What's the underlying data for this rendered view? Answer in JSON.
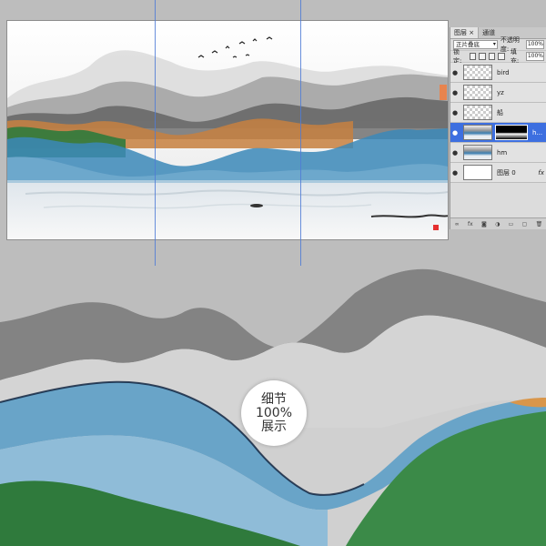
{
  "layers_panel": {
    "tabs": [
      "图层 ×",
      "通道"
    ],
    "blend_mode": "正片叠底",
    "opacity_label": "不透明度:",
    "opacity_value": "100%",
    "lock_label": "锁定:",
    "fill_label": "填充:",
    "fill_value": "100%",
    "layers": [
      {
        "name": "bird",
        "thumb": "transparent",
        "selected": false,
        "fx": false
      },
      {
        "name": "yz",
        "thumb": "transparent",
        "selected": false,
        "fx": false
      },
      {
        "name": "船",
        "thumb": "transparent",
        "selected": false,
        "fx": false
      },
      {
        "name": "h...",
        "thumb": "landscape-with-mask",
        "selected": true,
        "fx": false
      },
      {
        "name": "hm",
        "thumb": "landscape",
        "selected": false,
        "fx": false
      },
      {
        "name": "图层 0",
        "thumb": "white",
        "selected": false,
        "fx": true
      }
    ],
    "fx_label": "fx",
    "footer_icons": [
      "link-icon",
      "fx-icon",
      "mask-icon",
      "adjustment-icon",
      "group-icon",
      "new-layer-icon",
      "trash-icon"
    ]
  },
  "badge": {
    "line1": "细节",
    "line2": "100%",
    "line3": "展示"
  },
  "colors": {
    "selection_blue": "#3d6fe0",
    "orange_tag": "#e8844e",
    "guide_blue": "#4f7bd6"
  }
}
